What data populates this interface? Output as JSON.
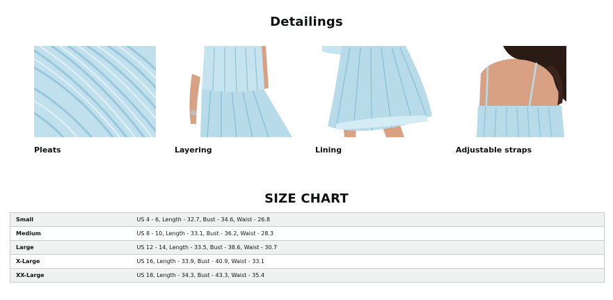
{
  "details": {
    "title": "Detailings",
    "items": [
      {
        "label": "Pleats",
        "image": "pleats-fabric-closeup"
      },
      {
        "label": "Layering",
        "image": "layered-dress-top"
      },
      {
        "label": "Lining",
        "image": "dress-skirt-lining"
      },
      {
        "label": "Adjustable straps",
        "image": "dress-back-straps"
      }
    ]
  },
  "size_chart": {
    "title": "SIZE CHART",
    "rows": [
      {
        "size": "Small",
        "spec": "US 4 - 6, Length - 32.7, Bust - 34.6, Waist - 26.8"
      },
      {
        "size": "Medium",
        "spec": "US 8 - 10, Length - 33.1, Bust - 36.2, Waist - 28.3"
      },
      {
        "size": "Large",
        "spec": "US 12 - 14, Length - 33.5, Bust - 38.6, Waist - 30.7"
      },
      {
        "size": "X-Large",
        "spec": "US 16, Length - 33.9, Bust - 40.9, Waist - 33.1"
      },
      {
        "size": "XX-Large",
        "spec": "US 18, Length - 34.3, Bust - 43.3, Waist - 35.4"
      }
    ]
  },
  "colors": {
    "fabric": "#b7dbe8",
    "fabric_shadow": "#8fc2d6",
    "skin": "#d9a184",
    "hair": "#2a1a14",
    "table_stripe": "#f0f2f2",
    "table_border": "#c9cccc"
  }
}
